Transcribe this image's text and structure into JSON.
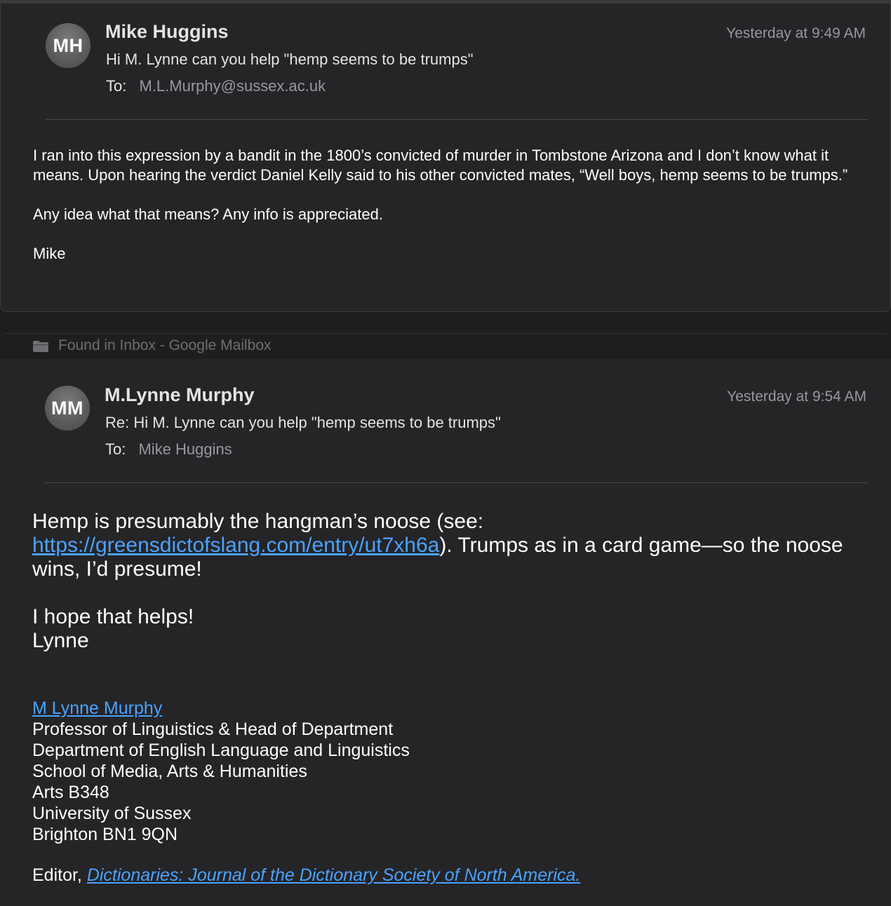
{
  "messages": [
    {
      "avatar_initials": "MH",
      "sender": "Mike Huggins",
      "subject": "Hi M. Lynne can you help \"hemp seems to be trumps\"",
      "to_label": "To:",
      "to_value": "M.L.Murphy@sussex.ac.uk",
      "date": "Yesterday at 9:49 AM",
      "body": [
        "I ran into this expression by a bandit in the 1800’s convicted of murder in Tombstone Arizona and I don’t know what it means. Upon hearing the verdict Daniel Kelly said to his other convicted mates, “Well boys, hemp seems to be trumps.”",
        "Any idea what that means? Any info is appreciated.",
        "Mike"
      ]
    },
    {
      "avatar_initials": "MM",
      "sender": "M.Lynne Murphy",
      "subject": "Re: Hi M. Lynne can you help \"hemp seems to be trumps\"",
      "to_label": "To:",
      "to_value": "Mike Huggins",
      "date": "Yesterday at 9:54 AM",
      "body": {
        "para1_before": "Hemp is presumably the hangman’s noose (see: ",
        "para1_link": "https://greensdictofslang.com/entry/ut7xh6a",
        "para1_after": "). Trumps as in a card game—so the noose wins, I’d presume!",
        "para2_line1": "I hope that helps!",
        "para2_line2": "Lynne"
      },
      "signature": {
        "name_link": "M Lynne Murphy",
        "lines": [
          "Professor of Linguistics & Head of Department",
          "Department of English Language and Linguistics",
          "School of Media, Arts & Humanities",
          "Arts B348",
          "University of Sussex",
          "Brighton BN1 9QN"
        ],
        "editor_label": "Editor, ",
        "editor_link": "Dictionaries: Journal of the Dictionary Society of North America."
      }
    }
  ],
  "found_in": {
    "icon": "folder-icon",
    "text": "Found in Inbox - Google Mailbox"
  },
  "colors": {
    "background": "#1e1e1e",
    "message_bg": "#252427",
    "link": "#4aa3ff",
    "secondary_text": "#98989d"
  }
}
